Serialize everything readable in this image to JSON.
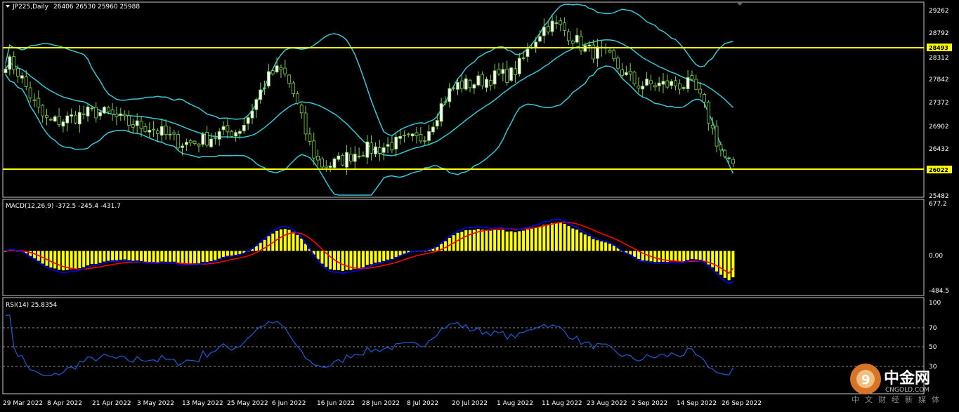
{
  "chart_title": "JP225,Daily",
  "ohlc": "26406 26530 25960 25988",
  "colors": {
    "background": "#000000",
    "frame": "#c8c8c8",
    "bull_candle": "#ffffff",
    "bear_candle": "#000000",
    "wick": "#7fd04b",
    "bollinger": "#34c7d6",
    "level_line": "#ffff00",
    "macd_hist": "#ffff00",
    "macd_main": "#0000ff",
    "macd_signal": "#ff0000",
    "rsi_line": "#1f5bd6",
    "rsi_level": "#8a8a8a"
  },
  "price_axis": [
    "29262",
    "28792",
    "28312",
    "27842",
    "27372",
    "26902",
    "26432",
    "25482"
  ],
  "level_labels": [
    "28493",
    "26022"
  ],
  "macd_label": "MACD(12,26,9) -372.5 -245.4 -431.7",
  "macd_axis": [
    "677.2",
    "0.00",
    "-484.5"
  ],
  "rsi_label": "RSI(14) 25.8354",
  "rsi_axis": [
    "100",
    "70",
    "50",
    "30"
  ],
  "x_axis": [
    "29 Mar 2022",
    "8 Apr 2022",
    "21 Apr 2022",
    "3 May 2022",
    "13 May 2022",
    "25 May 2022",
    "6 Jun 2022",
    "16 Jun 2022",
    "28 Jun 2022",
    "8 Jul 2022",
    "20 Jul 2022",
    "1 Aug 2022",
    "11 Aug 2022",
    "23 Aug 2022",
    "2 Sep 2022",
    "14 Sep 2022",
    "26 Sep 2022"
  ],
  "watermark": {
    "name": "中金网",
    "domain": "CNGOLD.COM",
    "tagline": "中文财经新媒体"
  },
  "chart_data": [
    {
      "type": "candlestick",
      "title": "JP225,Daily",
      "ylim": [
        25300,
        29450
      ],
      "levels": [
        28493,
        26022
      ],
      "key_points": [
        {
          "date": "29 Mar 2022",
          "close": 28200
        },
        {
          "date": "8 Apr 2022",
          "close": 26900
        },
        {
          "date": "21 Apr 2022",
          "close": 27100
        },
        {
          "date": "3 May 2022",
          "close": 26800
        },
        {
          "date": "13 May 2022",
          "close": 26430
        },
        {
          "date": "25 May 2022",
          "close": 26680
        },
        {
          "date": "6 Jun 2022",
          "close": 28000
        },
        {
          "date": "16 Jun 2022",
          "close": 25950
        },
        {
          "date": "28 Jun 2022",
          "close": 26300
        },
        {
          "date": "8 Jul 2022",
          "close": 26500
        },
        {
          "date": "20 Jul 2022",
          "close": 27700
        },
        {
          "date": "1 Aug 2022",
          "close": 27900
        },
        {
          "date": "11 Aug 2022",
          "close": 29000
        },
        {
          "date": "23 Aug 2022",
          "close": 28400
        },
        {
          "date": "2 Sep 2022",
          "close": 27700
        },
        {
          "date": "14 Sep 2022",
          "close": 27700
        },
        {
          "date": "26 Sep 2022",
          "close": 25988
        }
      ]
    },
    {
      "type": "bar",
      "title": "MACD(12,26,9)",
      "ylim": [
        -600,
        700
      ],
      "last": {
        "histogram": -372.5,
        "signal": -245.4,
        "main": -431.7
      }
    },
    {
      "type": "line",
      "title": "RSI(14)",
      "ylim": [
        0,
        100
      ],
      "levels": [
        70,
        50,
        30
      ],
      "last": 25.8354
    }
  ]
}
